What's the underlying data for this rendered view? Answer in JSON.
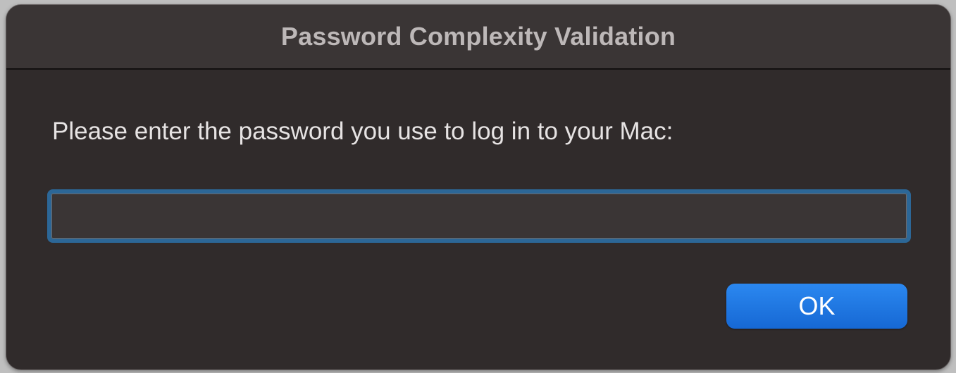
{
  "dialog": {
    "title": "Password Complexity Validation",
    "prompt": "Please enter the password you use to log in to your Mac:",
    "password_value": "",
    "ok_label": "OK"
  },
  "colors": {
    "dialog_background": "#302b2b",
    "titlebar_background": "#3a3535",
    "input_focus_ring": "#2c6797",
    "button_accent": "#1f78e6"
  }
}
